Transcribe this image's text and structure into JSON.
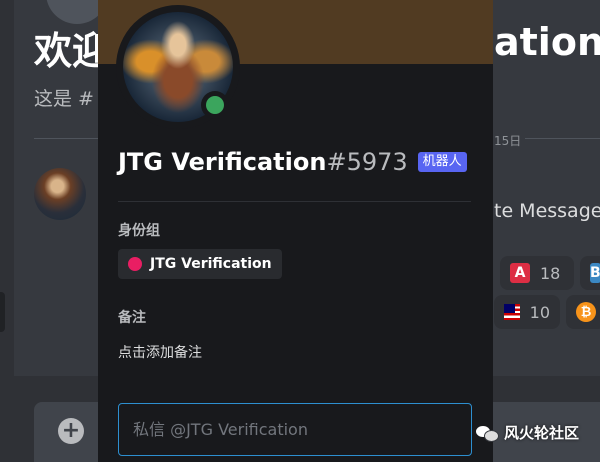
{
  "background": {
    "welcome_title_left": "欢迎",
    "welcome_title_right": "ation!",
    "welcome_subtitle": "这是 #",
    "date_fragment": "15日",
    "message_fragment": "te Message",
    "reactions": [
      {
        "icon": "letter-a-icon",
        "count": "18"
      },
      {
        "icon": "letter-b-icon",
        "count": ""
      },
      {
        "icon": "malaysia-flag-icon",
        "count": "10"
      },
      {
        "icon": "bitcoin-icon",
        "count": ""
      }
    ],
    "reaction_a_glyph": "A",
    "reaction_b_glyph": "B",
    "reaction_btc_glyph": "₿"
  },
  "popout": {
    "username": "JTG Verification",
    "discriminator": "#5973",
    "bot_tag": "机器人",
    "status": "online",
    "status_color": "#3ba55d",
    "roles_title": "身份组",
    "roles": [
      {
        "name": "JTG Verification",
        "color": "#e91e63"
      }
    ],
    "note_title": "备注",
    "note_placeholder": "点击添加备注",
    "dm_placeholder": "私信 @JTG Verification"
  },
  "chat": {
    "plus_glyph": "+"
  },
  "watermark": {
    "text": "风火轮社区"
  },
  "colors": {
    "accent": "#5865f2",
    "input_focus": "#2d8fd0",
    "banner": "#513b22"
  }
}
